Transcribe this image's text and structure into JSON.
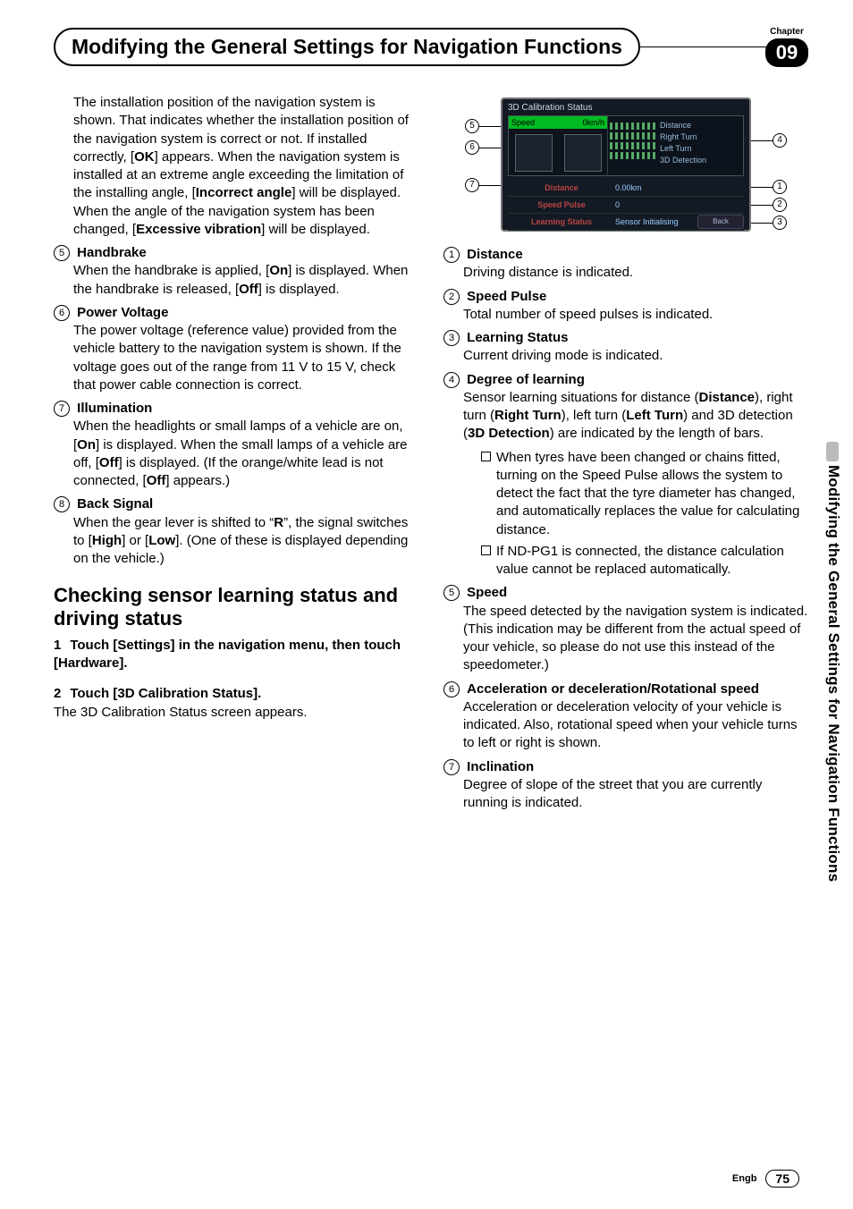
{
  "header": {
    "chapter_label": "Chapter",
    "chapter_number": "09",
    "title": "Modifying the General Settings for Navigation Functions"
  },
  "side_tab": "Modifying the General Settings for Navigation Functions",
  "footer": {
    "lang": "Engb",
    "page": "75"
  },
  "left": {
    "intro": "The installation position of the navigation system is shown. That indicates whether the installation position of the navigation system is correct or not. If installed correctly, [OK] appears. When the navigation system is installed at an extreme angle exceeding the limitation of the installing angle, [Incorrect angle] will be displayed. When the angle of the navigation system has been changed, [Excessive vibration] will be displayed.",
    "items": [
      {
        "n": "5",
        "title": "Handbrake",
        "body": "When the handbrake is applied, [On] is displayed. When the handbrake is released, [Off] is displayed."
      },
      {
        "n": "6",
        "title": "Power Voltage",
        "body": "The power voltage (reference value) provided from the vehicle battery to the navigation system is shown. If the voltage goes out of the range from 11 V to 15 V, check that power cable connection is correct."
      },
      {
        "n": "7",
        "title": "Illumination",
        "body": "When the headlights or small lamps of a vehicle are on, [On] is displayed. When the small lamps of a vehicle are off, [Off] is displayed. (If the orange/white lead is not connected, [Off] appears.)"
      },
      {
        "n": "8",
        "title": "Back Signal",
        "body": "When the gear lever is shifted to “R”, the signal switches to [High] or [Low]. (One of these is displayed depending on the vehicle.)"
      }
    ],
    "section_heading": "Checking sensor learning status and driving status",
    "steps": [
      {
        "n": "1",
        "bold": "Touch [Settings] in the navigation menu, then touch [Hardware]."
      },
      {
        "n": "2",
        "bold": "Touch [3D Calibration Status].",
        "after": "The 3D Calibration Status screen appears."
      }
    ]
  },
  "shot": {
    "title": "3D Calibration Status",
    "speed_label": "Speed",
    "speed_unit": "0km/h",
    "learn_labels": [
      "Distance",
      "Right Turn",
      "Left Turn",
      "3D Detection"
    ],
    "row1_label": "Distance",
    "row1_val": "0.00km",
    "row2_label": "Speed Pulse",
    "row2_val": "0",
    "row3_label": "Learning Status",
    "row3_val": "Sensor Initialising",
    "back_btn": "Back",
    "left_callouts": [
      "5",
      "6",
      "7"
    ],
    "right_callouts": [
      "4",
      "1",
      "2",
      "3"
    ]
  },
  "right": {
    "items": [
      {
        "n": "1",
        "title": "Distance",
        "body": "Driving distance is indicated."
      },
      {
        "n": "2",
        "title": "Speed Pulse",
        "body": "Total number of speed pulses is indicated."
      },
      {
        "n": "3",
        "title": "Learning Status",
        "body": "Current driving mode is indicated."
      },
      {
        "n": "4",
        "title": "Degree of learning",
        "body": "Sensor learning situations for distance (Distance), right turn (Right Turn), left turn (Left Turn) and 3D detection (3D Detection) are indicated by the length of bars.",
        "subs": [
          "When tyres have been changed or chains fitted, turning on the Speed Pulse allows the system to detect the fact that the tyre diameter has changed, and automatically replaces the value for calculating distance.",
          "If ND-PG1 is connected, the distance calculation value cannot be replaced automatically."
        ]
      },
      {
        "n": "5",
        "title": "Speed",
        "body": "The speed detected by the navigation system is indicated. (This indication may be different from the actual speed of your vehicle, so please do not use this instead of the speedometer.)"
      },
      {
        "n": "6",
        "title": "Acceleration or deceleration/Rotational speed",
        "body": "Acceleration or deceleration velocity of your vehicle is indicated. Also, rotational speed when your vehicle turns to left or right is shown."
      },
      {
        "n": "7",
        "title": "Inclination",
        "body": "Degree of slope of the street that you are currently running is indicated."
      }
    ]
  }
}
